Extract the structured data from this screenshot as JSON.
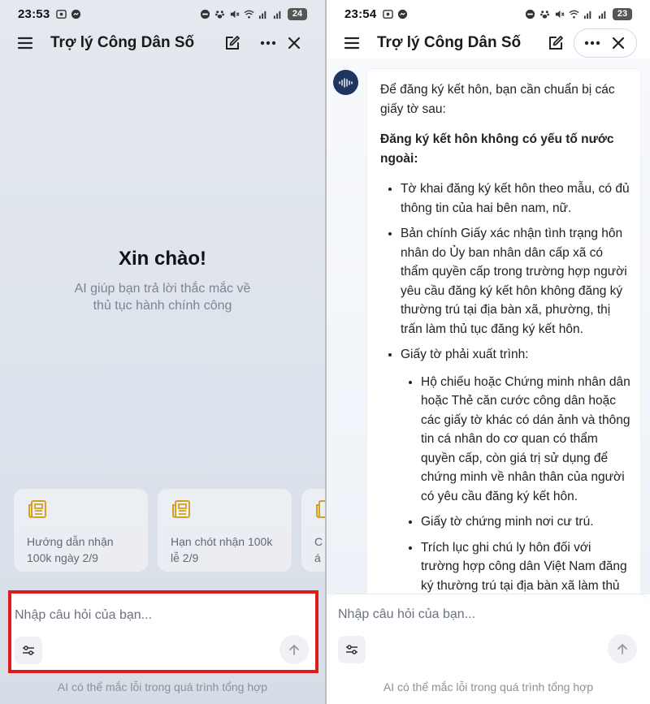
{
  "left": {
    "status": {
      "time": "23:53",
      "battery": "24"
    },
    "header": {
      "title": "Trợ lý Công Dân Số"
    },
    "welcome": {
      "title": "Xin chào!",
      "subtitle": "AI giúp bạn trả lời thắc mắc về thủ tục hành chính công"
    },
    "cards": [
      {
        "text": "Hướng dẫn nhận 100k ngày 2/9",
        "icon": "news-icon"
      },
      {
        "text": "Hạn chót nhận 100k lễ 2/9",
        "icon": "news-icon"
      },
      {
        "text": "Cá sử",
        "icon": "news-icon"
      }
    ],
    "input": {
      "placeholder": "Nhập câu hỏi của bạn..."
    },
    "disclaimer": "AI có thể mắc lỗi trong quá trình tổng hợp",
    "highlight_color": "#e01b1b"
  },
  "right": {
    "status": {
      "time": "23:54",
      "battery": "23"
    },
    "header": {
      "title": "Trợ lý Công Dân Số"
    },
    "message": {
      "intro": "Để đăng ký kết hôn, bạn cần chuẩn bị các giấy tờ sau:",
      "heading": "Đăng ký kết hôn không có yếu tố nước ngoài:",
      "items": [
        "Tờ khai đăng ký kết hôn theo mẫu, có đủ thông tin của hai bên nam, nữ.",
        "Bản chính Giấy xác nhận tình trạng hôn nhân do Ủy ban nhân dân cấp xã có thẩm quyền cấp trong trường hợp người yêu cầu đăng ký kết hôn không đăng ký thường trú tại địa bàn xã, phường, thị trấn làm thủ tục đăng ký kết hôn.",
        "Giấy tờ phải xuất trình:"
      ],
      "subitems": [
        "Hộ chiếu hoặc Chứng minh nhân dân hoặc Thẻ căn cước công dân hoặc các giấy tờ khác có dán ảnh và thông tin cá nhân do cơ quan có thẩm quyền cấp, còn giá trị sử dụng để chứng minh về nhân thân của người có yêu cầu đăng ký kết hôn.",
        "Giấy tờ chứng minh nơi cư trú.",
        "Trích lục ghi chú ly hôn đối với trường hợp công dân Việt Nam đăng ký thường trú tại địa bàn xã làm thủ tục"
      ]
    },
    "input": {
      "placeholder": "Nhập câu hỏi của bạn..."
    },
    "disclaimer": "AI có thể mắc lỗi trong quá trình tổng hợp",
    "avatar_color": "#1d3560"
  }
}
